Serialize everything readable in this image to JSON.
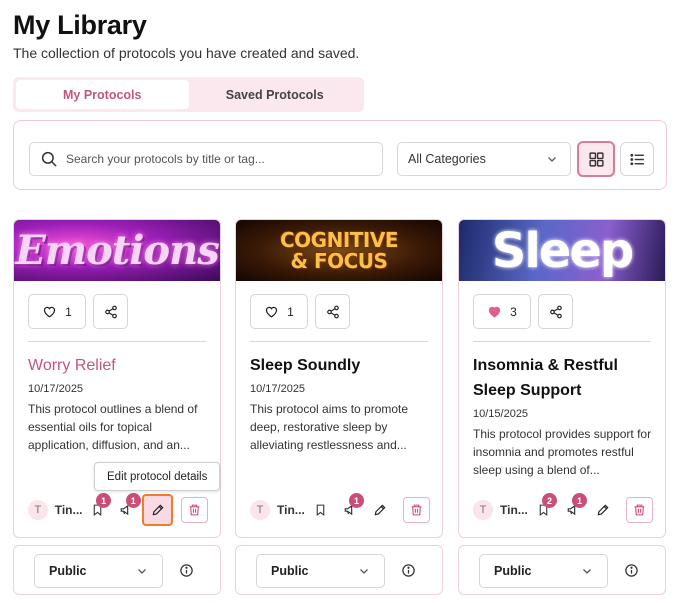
{
  "page": {
    "title": "My Library",
    "subtitle": "The collection of protocols you have created and saved."
  },
  "tabs": [
    {
      "label": "My Protocols",
      "active": true
    },
    {
      "label": "Saved Protocols",
      "active": false
    }
  ],
  "filters": {
    "search_placeholder": "Search your protocols by title or tag...",
    "category_selected": "All Categories",
    "view_mode": "grid"
  },
  "tooltip": "Edit protocol details",
  "cards": [
    {
      "banner_text": "Emotions",
      "likes": "1",
      "liked": false,
      "title": "Worry Relief",
      "date": "10/17/2025",
      "description": "This protocol outlines a blend of essential oils for topical application, diffusion, and an...",
      "author_initial": "T",
      "author": "Tin...",
      "bookmark_count": "1",
      "comment_count": "1",
      "visibility": "Public"
    },
    {
      "banner_text_line1": "COGNITIVE",
      "banner_text_line2": "& FOCUS",
      "likes": "1",
      "liked": false,
      "title": "Sleep Soundly",
      "date": "10/17/2025",
      "description": "This protocol aims to promote deep, restorative sleep by alleviating restlessness and...",
      "author_initial": "T",
      "author": "Tin...",
      "bookmark_count": "",
      "comment_count": "1",
      "visibility": "Public"
    },
    {
      "banner_text": "Sleep",
      "likes": "3",
      "liked": true,
      "title": "Insomnia & Restful Sleep Support",
      "date": "10/15/2025",
      "description": "This protocol provides support for insomnia and promotes restful sleep using a blend of...",
      "author_initial": "T",
      "author": "Tin...",
      "bookmark_count": "2",
      "comment_count": "1",
      "visibility": "Public"
    }
  ],
  "colors": {
    "accent": "#c2577a",
    "badge": "#c94f77",
    "tab_bg": "#fbe8ee",
    "focus_ring": "#f07a2e"
  },
  "icons": [
    "search-icon",
    "chevron-down-icon",
    "grid-view-icon",
    "list-view-icon",
    "heart-icon",
    "share-icon",
    "bookmark-icon",
    "megaphone-icon",
    "pencil-icon",
    "trash-icon",
    "info-icon"
  ]
}
